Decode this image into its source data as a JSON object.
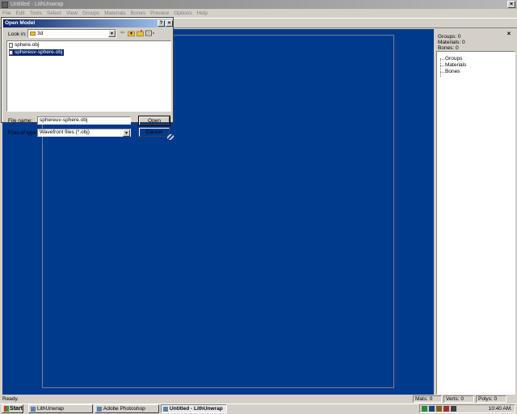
{
  "window": {
    "title": "Untitled - LithUnwrap",
    "close": "×"
  },
  "menu": [
    "File",
    "Edit",
    "Tools",
    "Select",
    "View",
    "Groups",
    "Materials",
    "Bones",
    "Preview",
    "Options",
    "Help"
  ],
  "panel": {
    "close": "×",
    "groups": "Groups: 0",
    "materials": "Materials: 0",
    "bones": "Bones: 0",
    "tree": [
      "Groups",
      "Materials",
      "Bones"
    ]
  },
  "status": {
    "text": "Ready.",
    "mats": "Mats: 0",
    "verts": "Verts: 0",
    "polys": "Polys: 0"
  },
  "taskbar": {
    "start": "Start",
    "tasks": [
      "LithUnwrap",
      "Adobe Photoshop",
      "Untitled - LithUnwrap"
    ],
    "clock": "10:40 AM."
  },
  "dialog": {
    "title": "Open Model",
    "help_btn": "?",
    "close_btn": "×",
    "lookin_label": "Look in:",
    "lookin_value": "3d",
    "files": [
      "sphere.obj",
      "sphereuv-sphere.obj"
    ],
    "selected_index": 1,
    "filename_label": "File name:",
    "filename_value": "sphereuv-sphere.obj",
    "filetype_label": "Files of type:",
    "filetype_value": "Wavefront files (*.obj)",
    "open": "Open",
    "cancel": "Cancel"
  },
  "colors": {
    "viewport": "#003a8c",
    "selection": "#0a246a"
  },
  "icons": {
    "back": "back-arrow-icon",
    "up": "up-folder-icon",
    "newfolder": "new-folder-icon",
    "views": "view-menu-icon"
  }
}
